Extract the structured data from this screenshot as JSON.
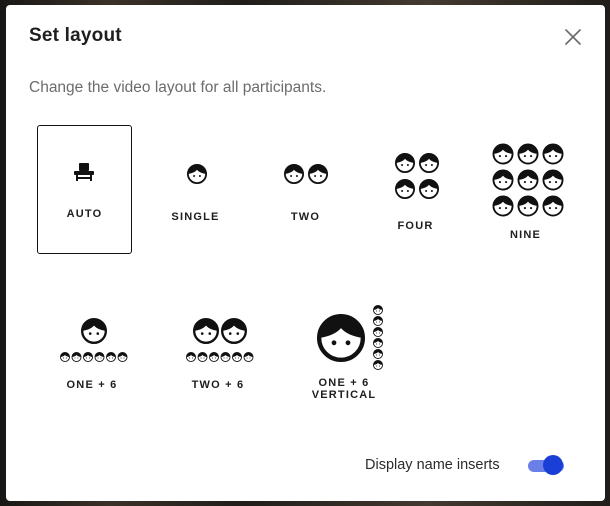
{
  "dialog": {
    "title": "Set layout",
    "subtitle": "Change the video layout for all participants.",
    "close_icon": "close-icon"
  },
  "layouts": [
    {
      "id": "auto",
      "label": "AUTO",
      "icon": "seat-icon",
      "selected": true
    },
    {
      "id": "single",
      "label": "SINGLE",
      "icon": "single-face-icon",
      "selected": false
    },
    {
      "id": "two",
      "label": "TWO",
      "icon": "two-faces-icon",
      "selected": false
    },
    {
      "id": "four",
      "label": "FOUR",
      "icon": "four-faces-icon",
      "selected": false
    },
    {
      "id": "nine",
      "label": "NINE",
      "icon": "nine-faces-icon",
      "selected": false
    },
    {
      "id": "one_plus_6",
      "label": "ONE + 6",
      "icon": "one-plus-six-icon",
      "selected": false
    },
    {
      "id": "two_plus_6",
      "label": "TWO + 6",
      "icon": "two-plus-six-icon",
      "selected": false
    },
    {
      "id": "one_plus_6_vertical",
      "label_line1": "ONE + 6",
      "label_line2": "VERTICAL",
      "icon": "one-plus-six-vertical-icon",
      "selected": false
    }
  ],
  "name_inserts": {
    "label": "Display name inserts",
    "enabled": true
  },
  "colors": {
    "accent": "#1a3fd6",
    "track": "#6a80e8"
  }
}
